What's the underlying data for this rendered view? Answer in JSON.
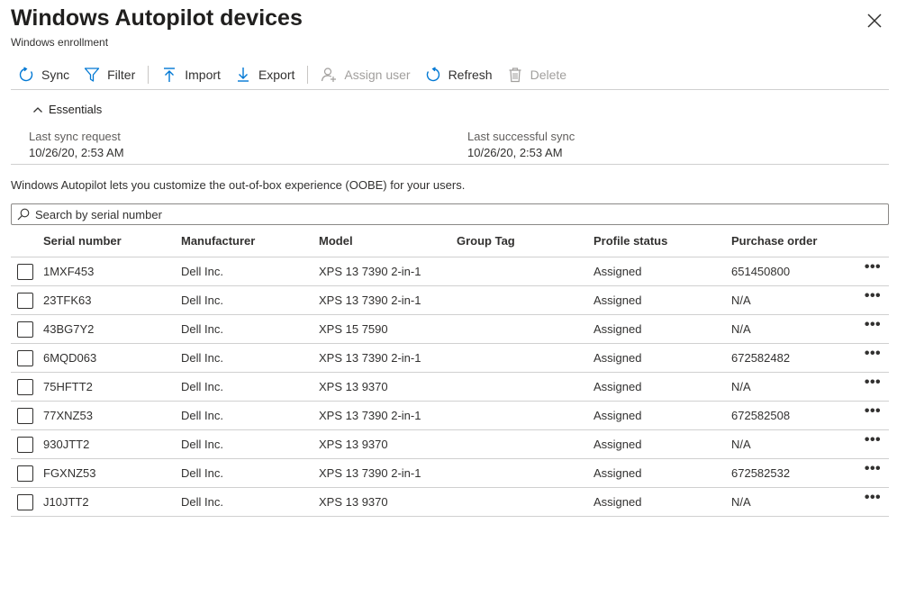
{
  "header": {
    "title": "Windows Autopilot devices",
    "subtitle": "Windows enrollment",
    "close_icon": "close-icon"
  },
  "toolbar": {
    "items": [
      {
        "label": "Sync",
        "icon": "sync-icon",
        "enabled": true
      },
      {
        "label": "Filter",
        "icon": "filter-icon",
        "enabled": true
      },
      {
        "label": "Import",
        "icon": "import-icon",
        "enabled": true
      },
      {
        "label": "Export",
        "icon": "export-icon",
        "enabled": true
      },
      {
        "label": "Assign user",
        "icon": "assign-user-icon",
        "enabled": false
      },
      {
        "label": "Refresh",
        "icon": "refresh-icon",
        "enabled": true
      },
      {
        "label": "Delete",
        "icon": "delete-icon",
        "enabled": false
      }
    ]
  },
  "essentials": {
    "heading": "Essentials",
    "last_sync_request_label": "Last sync request",
    "last_sync_request_value": "10/26/20, 2:53 AM",
    "last_successful_sync_label": "Last successful sync",
    "last_successful_sync_value": "10/26/20, 2:53 AM"
  },
  "description": "Windows Autopilot lets you customize the out-of-box experience (OOBE) for your users.",
  "search": {
    "placeholder": "Search by serial number",
    "value": ""
  },
  "table": {
    "columns": [
      "Serial number",
      "Manufacturer",
      "Model",
      "Group Tag",
      "Profile status",
      "Purchase order"
    ],
    "rows": [
      {
        "serial": "1MXF453",
        "manufacturer": "Dell Inc.",
        "model": "XPS 13 7390 2-in-1",
        "group_tag": "",
        "status": "Assigned",
        "po": "651450800"
      },
      {
        "serial": "23TFK63",
        "manufacturer": "Dell Inc.",
        "model": "XPS 13 7390 2-in-1",
        "group_tag": "",
        "status": "Assigned",
        "po": "N/A"
      },
      {
        "serial": "43BG7Y2",
        "manufacturer": "Dell Inc.",
        "model": "XPS 15 7590",
        "group_tag": "",
        "status": "Assigned",
        "po": "N/A"
      },
      {
        "serial": "6MQD063",
        "manufacturer": "Dell Inc.",
        "model": "XPS 13 7390 2-in-1",
        "group_tag": "",
        "status": "Assigned",
        "po": "672582482"
      },
      {
        "serial": "75HFTT2",
        "manufacturer": "Dell Inc.",
        "model": "XPS 13 9370",
        "group_tag": "",
        "status": "Assigned",
        "po": "N/A"
      },
      {
        "serial": "77XNZ53",
        "manufacturer": "Dell Inc.",
        "model": "XPS 13 7390 2-in-1",
        "group_tag": "",
        "status": "Assigned",
        "po": "672582508"
      },
      {
        "serial": "930JTT2",
        "manufacturer": "Dell Inc.",
        "model": "XPS 13 9370",
        "group_tag": "",
        "status": "Assigned",
        "po": "N/A"
      },
      {
        "serial": "FGXNZ53",
        "manufacturer": "Dell Inc.",
        "model": "XPS 13 7390 2-in-1",
        "group_tag": "",
        "status": "Assigned",
        "po": "672582532"
      },
      {
        "serial": "J10JTT2",
        "manufacturer": "Dell Inc.",
        "model": "XPS 13 9370",
        "group_tag": "",
        "status": "Assigned",
        "po": "N/A"
      }
    ],
    "row_more_label": "•••"
  },
  "colors": {
    "accent": "#0078d4",
    "text": "#323130",
    "disabled": "#a19f9d",
    "divider": "#d0d0d0"
  }
}
